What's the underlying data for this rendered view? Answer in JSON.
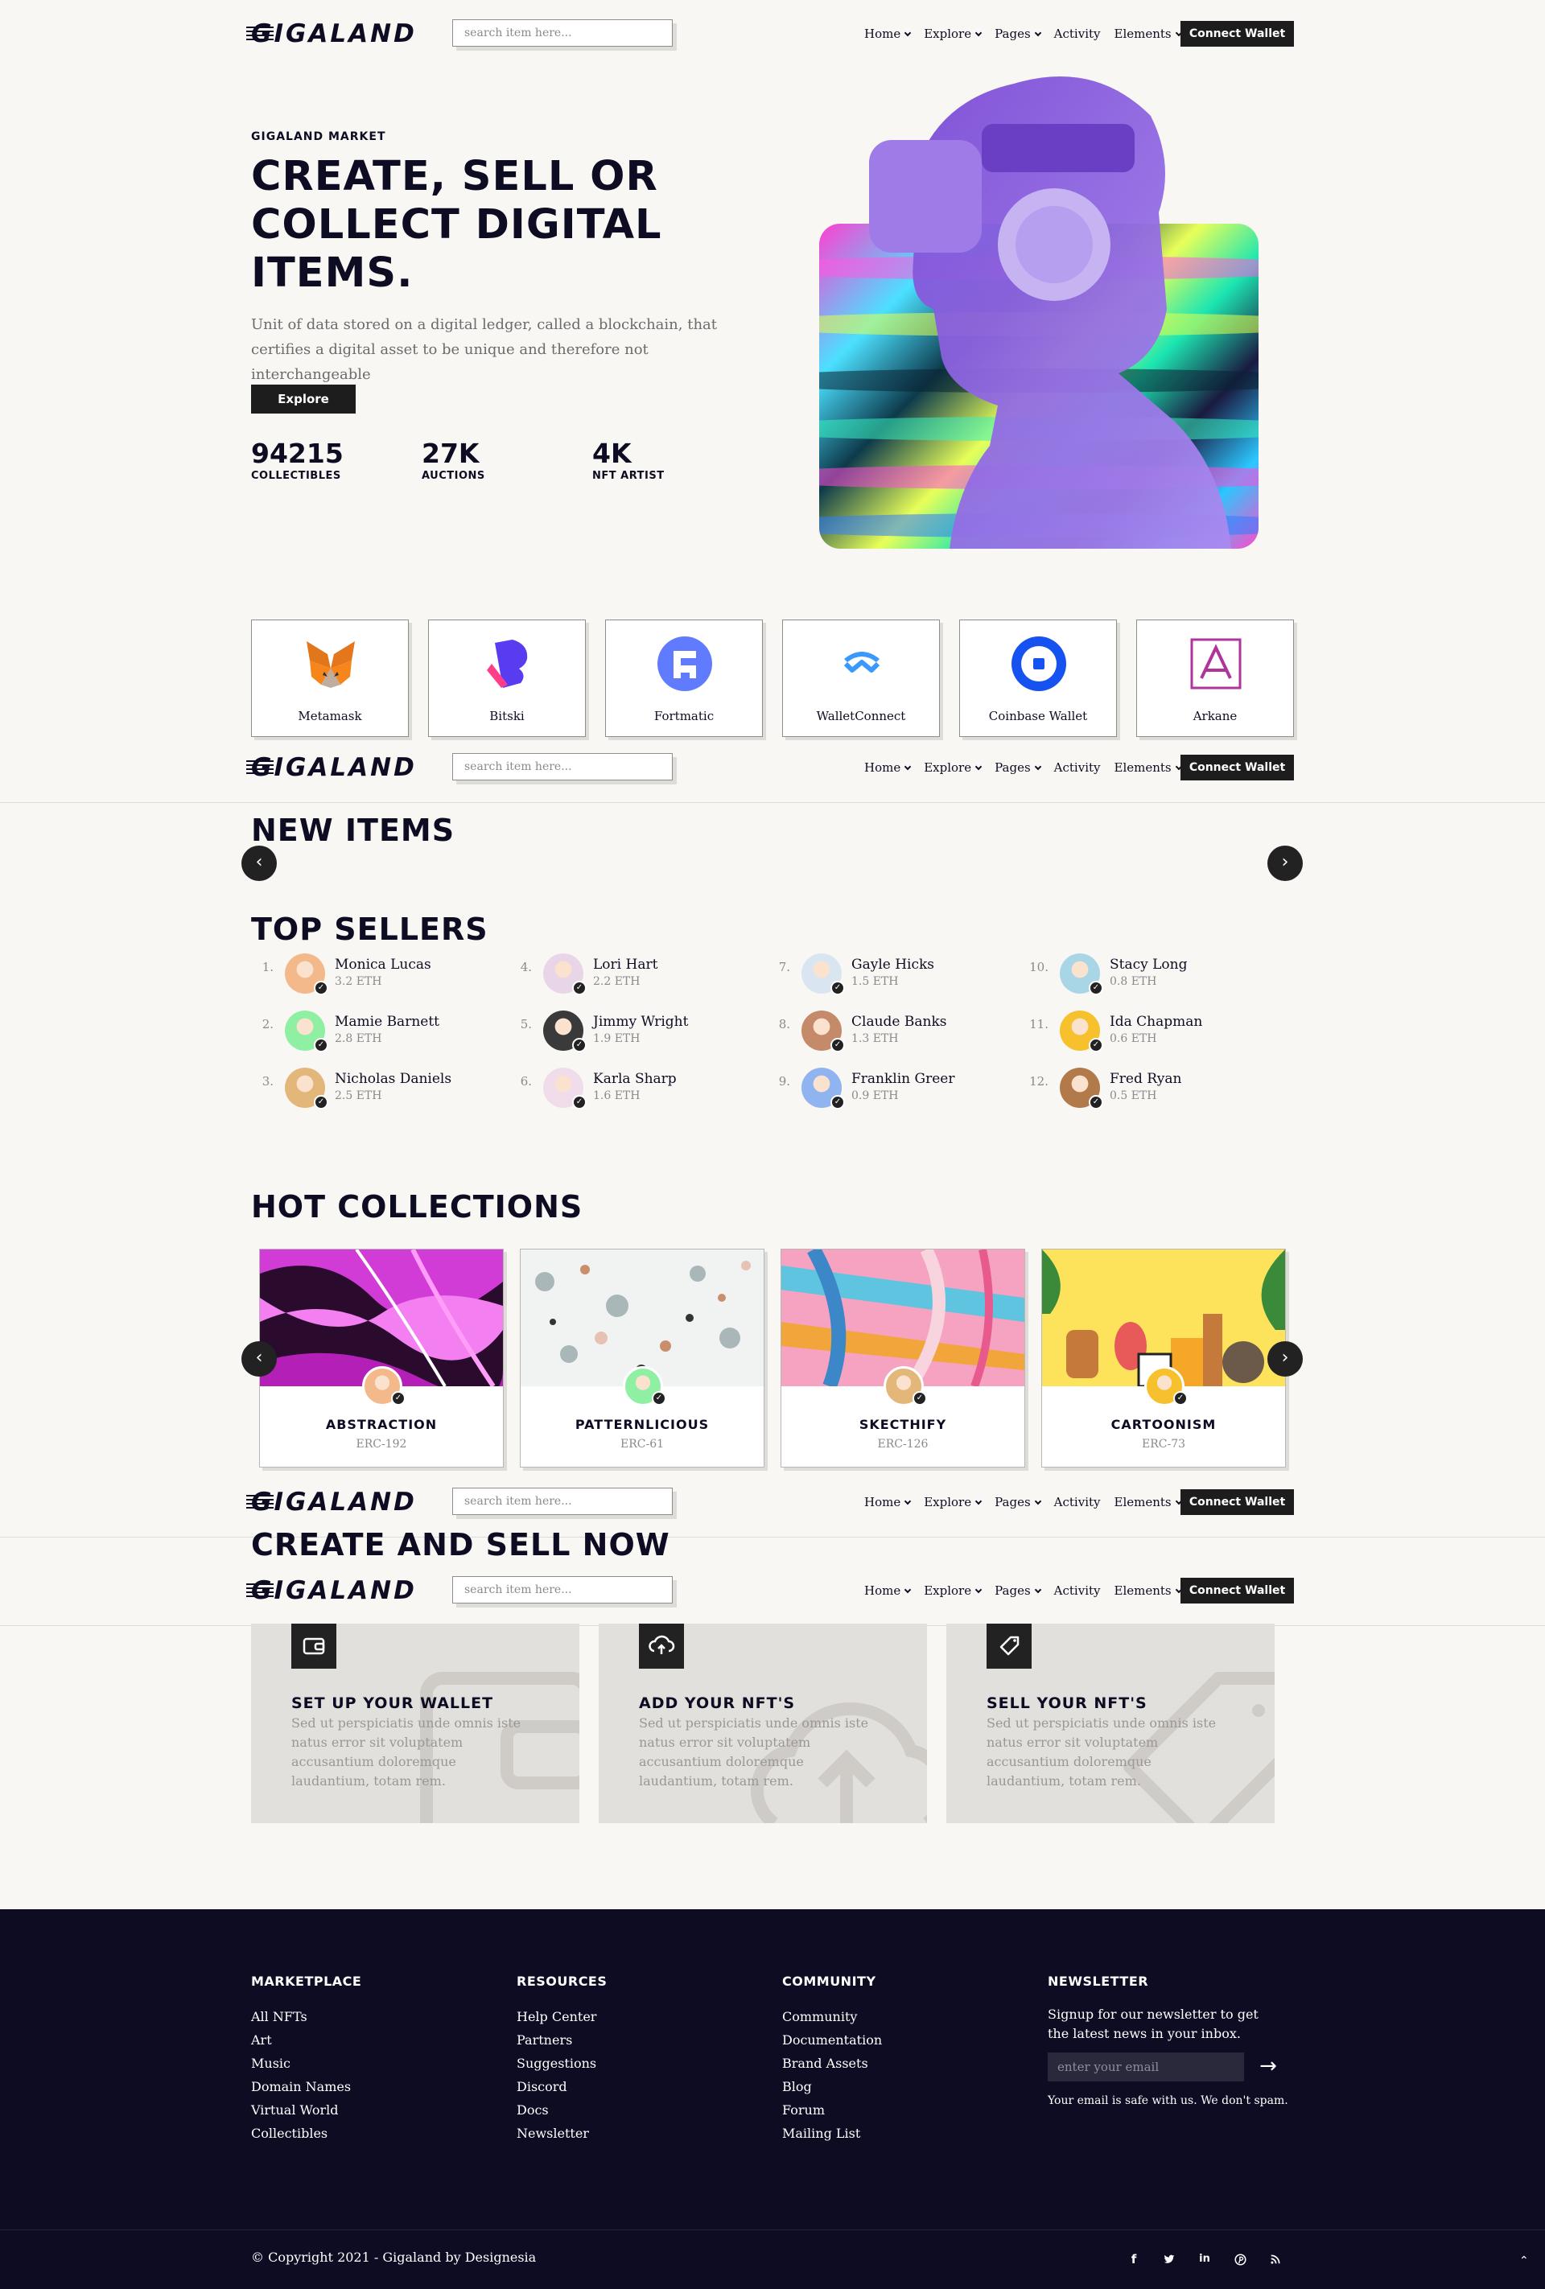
{
  "header": {
    "logo": "GIGALAND",
    "search_placeholder": "search item here...",
    "nav": [
      "Home",
      "Explore",
      "Pages",
      "Activity",
      "Elements"
    ],
    "connect": "Connect Wallet"
  },
  "hero": {
    "eyebrow": "Gigaland Market",
    "title": "Create, Sell or Collect Digital Items.",
    "description": "Unit of data stored on a digital ledger, called a blockchain, that certifies a digital asset to be unique and therefore not interchangeable",
    "button": "Explore",
    "stats": [
      {
        "value": "94215",
        "label": "Collectibles"
      },
      {
        "value": "27K",
        "label": "Auctions"
      },
      {
        "value": "4K",
        "label": "NFT Artist"
      }
    ]
  },
  "wallets": [
    {
      "name": "Metamask",
      "icon": "metamask-fox-icon",
      "color": "#e2761b"
    },
    {
      "name": "Bitski",
      "icon": "bitski-icon",
      "color": "#5a3cf0"
    },
    {
      "name": "Fortmatic",
      "icon": "fortmatic-icon",
      "color": "#617bff"
    },
    {
      "name": "WalletConnect",
      "icon": "walletconnect-icon",
      "color": "#3b99fc"
    },
    {
      "name": "Coinbase Wallet",
      "icon": "coinbase-icon",
      "color": "#1652f0"
    },
    {
      "name": "Arkane",
      "icon": "arkane-icon",
      "color": "#b0359a"
    }
  ],
  "sections": {
    "new_items": "New Items",
    "top_sellers": "Top Sellers",
    "hot_collections": "Hot Collections",
    "create_sell": "Create and Sell Now"
  },
  "sellers": [
    {
      "rank": "1.",
      "name": "Monica Lucas",
      "eth": "3.2 ETH",
      "color": "#f3b98a"
    },
    {
      "rank": "2.",
      "name": "Mamie Barnett",
      "eth": "2.8 ETH",
      "color": "#8ff0a4"
    },
    {
      "rank": "3.",
      "name": "Nicholas Daniels",
      "eth": "2.5 ETH",
      "color": "#e3b679"
    },
    {
      "rank": "4.",
      "name": "Lori Hart",
      "eth": "2.2 ETH",
      "color": "#e8d6e8"
    },
    {
      "rank": "5.",
      "name": "Jimmy Wright",
      "eth": "1.9 ETH",
      "color": "#3a3a3a"
    },
    {
      "rank": "6.",
      "name": "Karla Sharp",
      "eth": "1.6 ETH",
      "color": "#f1dcec"
    },
    {
      "rank": "7.",
      "name": "Gayle Hicks",
      "eth": "1.5 ETH",
      "color": "#d9e6f2"
    },
    {
      "rank": "8.",
      "name": "Claude Banks",
      "eth": "1.3 ETH",
      "color": "#c48a6a"
    },
    {
      "rank": "9.",
      "name": "Franklin Greer",
      "eth": "0.9 ETH",
      "color": "#8fb4ef"
    },
    {
      "rank": "10.",
      "name": "Stacy Long",
      "eth": "0.8 ETH",
      "color": "#a9d6e6"
    },
    {
      "rank": "11.",
      "name": "Ida Chapman",
      "eth": "0.6 ETH",
      "color": "#f6c12c"
    },
    {
      "rank": "12.",
      "name": "Fred Ryan",
      "eth": "0.5 ETH",
      "color": "#b27a4a"
    }
  ],
  "collections": [
    {
      "title": "Abstraction",
      "code": "ERC-192"
    },
    {
      "title": "Patternlicious",
      "code": "ERC-61"
    },
    {
      "title": "Skecthify",
      "code": "ERC-126"
    },
    {
      "title": "Cartoonism",
      "code": "ERC-73"
    }
  ],
  "steps": [
    {
      "title": "Set up your wallet",
      "desc": "Sed ut perspiciatis unde omnis iste natus error sit voluptatem accusantium doloremque laudantium, totam rem.",
      "icon": "wallet-icon"
    },
    {
      "title": "Add your NFT's",
      "desc": "Sed ut perspiciatis unde omnis iste natus error sit voluptatem accusantium doloremque laudantium, totam rem.",
      "icon": "cloud-upload-icon"
    },
    {
      "title": "Sell your NFT's",
      "desc": "Sed ut perspiciatis unde omnis iste natus error sit voluptatem accusantium doloremque laudantium, totam rem.",
      "icon": "tag-icon"
    }
  ],
  "footer": {
    "columns": [
      {
        "title": "Marketplace",
        "links": [
          "All NFTs",
          "Art",
          "Music",
          "Domain Names",
          "Virtual World",
          "Collectibles"
        ]
      },
      {
        "title": "Resources",
        "links": [
          "Help Center",
          "Partners",
          "Suggestions",
          "Discord",
          "Docs",
          "Newsletter"
        ]
      },
      {
        "title": "Community",
        "links": [
          "Community",
          "Documentation",
          "Brand Assets",
          "Blog",
          "Forum",
          "Mailing List"
        ]
      }
    ],
    "newsletter": {
      "title": "Newsletter",
      "text": "Signup for our newsletter to get the latest news in your inbox.",
      "placeholder": "enter your email",
      "note": "Your email is safe with us. We don't spam."
    },
    "copyright": "© Copyright 2021 - Gigaland by Designesia",
    "social": [
      {
        "icon": "facebook-icon",
        "glyph": "f"
      },
      {
        "icon": "twitter-icon",
        "glyph": "t"
      },
      {
        "icon": "linkedin-icon",
        "glyph": "in"
      },
      {
        "icon": "pinterest-icon",
        "glyph": "p"
      },
      {
        "icon": "rss-icon",
        "glyph": "r"
      }
    ]
  },
  "colors": {
    "accent": "#0d0c22",
    "button": "#1d1d1d",
    "background": "#f9f7f4",
    "footer": "#0d0c22"
  }
}
